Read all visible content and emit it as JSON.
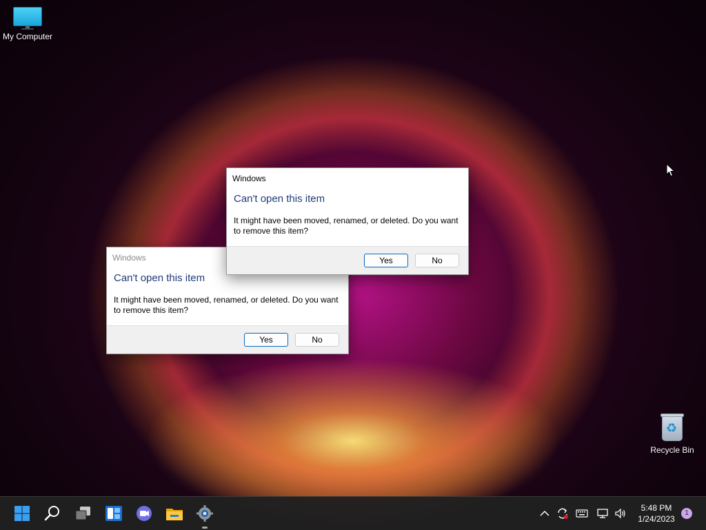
{
  "desktop": {
    "icons": [
      {
        "label": "My Computer"
      },
      {
        "label": "Recycle Bin"
      }
    ]
  },
  "dialogs": [
    {
      "title": "Windows",
      "heading": "Can't open this item",
      "message": "It might have been moved, renamed, or deleted. Do you want to remove this item?",
      "yes_label": "Yes",
      "no_label": "No",
      "state": "inactive"
    },
    {
      "title": "Windows",
      "heading": "Can't open this item",
      "message": "It might have been moved, renamed, or deleted. Do you want to remove this item?",
      "yes_label": "Yes",
      "no_label": "No",
      "state": "active"
    }
  ],
  "taskbar": {
    "pinned": [
      {
        "icon": "windows-start-icon"
      },
      {
        "icon": "search-icon"
      },
      {
        "icon": "task-view-icon"
      },
      {
        "icon": "widgets-icon"
      },
      {
        "icon": "teams-chat-icon"
      },
      {
        "icon": "file-explorer-icon"
      },
      {
        "icon": "settings-gear-icon"
      }
    ],
    "tray": {
      "time": "5:48 PM",
      "date": "1/24/2023",
      "notification_count": "1"
    }
  },
  "colors": {
    "accent": "#0067c0",
    "heading": "#1f3b78",
    "taskbar": "#202020"
  }
}
